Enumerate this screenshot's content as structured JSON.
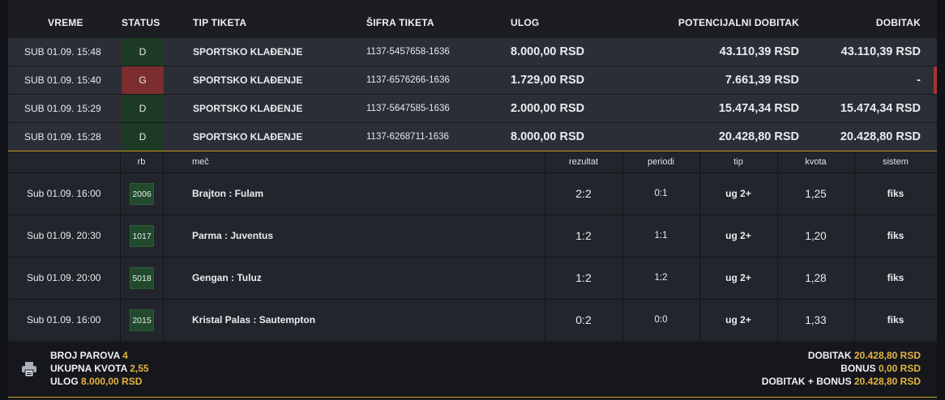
{
  "header": {
    "vreme": "VREME",
    "status": "STATUS",
    "tip_tiketa": "TIP TIKETA",
    "sifra_tiketa": "ŠIFRA TIKETA",
    "ulog": "ULOG",
    "potencijalni_dobitak": "POTENCIJALNI DOBITAK",
    "dobitak": "DOBITAK"
  },
  "tickets": [
    {
      "date": "SUB 01.09. 15:48",
      "status": "D",
      "type": "SPORTSKO KLAĐENJE",
      "code": "1137-5457658-1636",
      "stake": "8.000,00 RSD",
      "potential": "43.110,39 RSD",
      "win": "43.110,39 RSD",
      "status_color": "#1d3a26"
    },
    {
      "date": "SUB 01.09. 15:40",
      "status": "G",
      "type": "SPORTSKO KLAĐENJE",
      "code": "1137-6576266-1636",
      "stake": "1.729,00 RSD",
      "potential": "7.661,39 RSD",
      "win": "-",
      "status_color": "#7c2e2e"
    },
    {
      "date": "SUB 01.09. 15:29",
      "status": "D",
      "type": "SPORTSKO KLAĐENJE",
      "code": "1137-5647585-1636",
      "stake": "2.000,00 RSD",
      "potential": "15.474,34 RSD",
      "win": "15.474,34 RSD",
      "status_color": "#1d3a26"
    },
    {
      "date": "SUB 01.09. 15:28",
      "status": "D",
      "type": "SPORTSKO KLAĐENJE",
      "code": "1137-6268711-1636",
      "stake": "8.000,00 RSD",
      "potential": "20.428,80 RSD",
      "win": "20.428,80 RSD",
      "status_color": "#1d3a26"
    }
  ],
  "details": {
    "columns": {
      "rb": "rb",
      "mec": "meč",
      "rezultat": "rezultat",
      "periodi": "periodi",
      "tip": "tip",
      "kvota": "kvota",
      "sistem": "sistem"
    },
    "rows": [
      {
        "date": "Sub 01.09. 16:00",
        "rb": "2006",
        "match": "Brajton : Fulam",
        "result": "2:2",
        "periods": "0:1",
        "tip": "ug 2+",
        "odds": "1,25",
        "system": "fiks"
      },
      {
        "date": "Sub 01.09. 20:30",
        "rb": "1017",
        "match": "Parma : Juventus",
        "result": "1:2",
        "periods": "1:1",
        "tip": "ug 2+",
        "odds": "1,20",
        "system": "fiks"
      },
      {
        "date": "Sub 01.09. 20:00",
        "rb": "5018",
        "match": "Gengan : Tuluz",
        "result": "1:2",
        "periods": "1:2",
        "tip": "ug 2+",
        "odds": "1,28",
        "system": "fiks"
      },
      {
        "date": "Sub 01.09. 16:00",
        "rb": "2015",
        "match": "Kristal Palas : Sautempton",
        "result": "0:2",
        "periods": "0:0",
        "tip": "ug 2+",
        "odds": "1,33",
        "system": "fiks"
      }
    ]
  },
  "summary": {
    "broj_parova_label": "BROJ PAROVA",
    "broj_parova": "4",
    "ukupna_kvota_label": "UKUPNA KVOTA",
    "ukupna_kvota": "2,55",
    "ulog_label": "ULOG",
    "ulog": "8.000,00 RSD",
    "dobitak_label": "DOBITAK",
    "dobitak": "20.428,80 RSD",
    "bonus_label": "BONUS",
    "bonus": "0,00 RSD",
    "dobitak_bonus_label": "DOBITAK + BONUS",
    "dobitak_bonus": "20.428,80 RSD",
    "print_icon": "printer-icon"
  },
  "colors": {
    "accent": "#e3b341",
    "status_win": "#1d3a26",
    "status_lose": "#7c2e2e"
  }
}
